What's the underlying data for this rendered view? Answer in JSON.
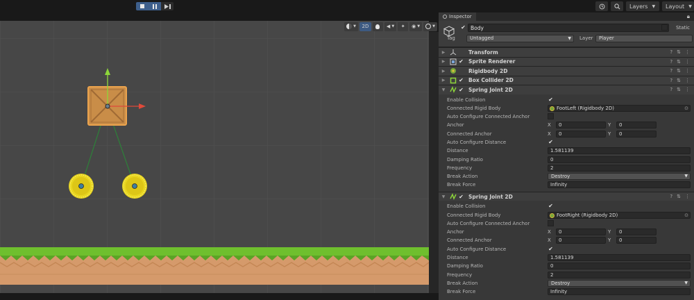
{
  "toolbar": {
    "play_icon": "stop-icon",
    "pause_icon": "pause-icon",
    "step_icon": "step-icon",
    "layers_label": "Layers",
    "layout_label": "Layout"
  },
  "scene_toolbar": {
    "mode_2d": "2D"
  },
  "inspector": {
    "tab_label": "Inspector",
    "object_name": "Body",
    "static_label": "Static",
    "tag_label": "Tag",
    "tag_value": "Untagged",
    "layer_label": "Layer",
    "layer_value": "Player"
  },
  "components": {
    "transform": "Transform",
    "sprite_renderer": "Sprite Renderer",
    "rigidbody": "Rigidbody 2D",
    "box_collider": "Box Collider 2D",
    "spring_joint_title": "Spring Joint 2D"
  },
  "spring_labels": {
    "enable_collision": "Enable Collision",
    "connected_rigid_body": "Connected Rigid Body",
    "auto_anchor": "Auto Configure Connected Anchor",
    "anchor": "Anchor",
    "connected_anchor": "Connected Anchor",
    "auto_distance": "Auto Configure Distance",
    "distance": "Distance",
    "damping_ratio": "Damping Ratio",
    "frequency": "Frequency",
    "break_action": "Break Action",
    "break_force": "Break Force",
    "x": "X",
    "y": "Y"
  },
  "spring1": {
    "connected_body": "FootLeft (Rigidbody 2D)",
    "anchor_x": "0",
    "anchor_y": "0",
    "conn_anchor_x": "0",
    "conn_anchor_y": "0",
    "distance": "1.581139",
    "damping_ratio": "0",
    "frequency": "2",
    "break_action": "Destroy",
    "break_force": "Infinity"
  },
  "spring2": {
    "connected_body": "FootRight (Rigidbody 2D)",
    "anchor_x": "0",
    "anchor_y": "0",
    "conn_anchor_x": "0",
    "conn_anchor_y": "0",
    "distance": "1.581139",
    "damping_ratio": "0",
    "frequency": "2",
    "break_action": "Destroy",
    "break_force": "Infinity"
  },
  "colors": {
    "scene_bg": "#474747",
    "crate": "#c98d48",
    "wheel": "#e6d42a",
    "grass": "#6fbf2e",
    "dirt": "#d59a6b",
    "gizmo_up": "#8dd63a",
    "gizmo_right": "#e04a3a"
  }
}
